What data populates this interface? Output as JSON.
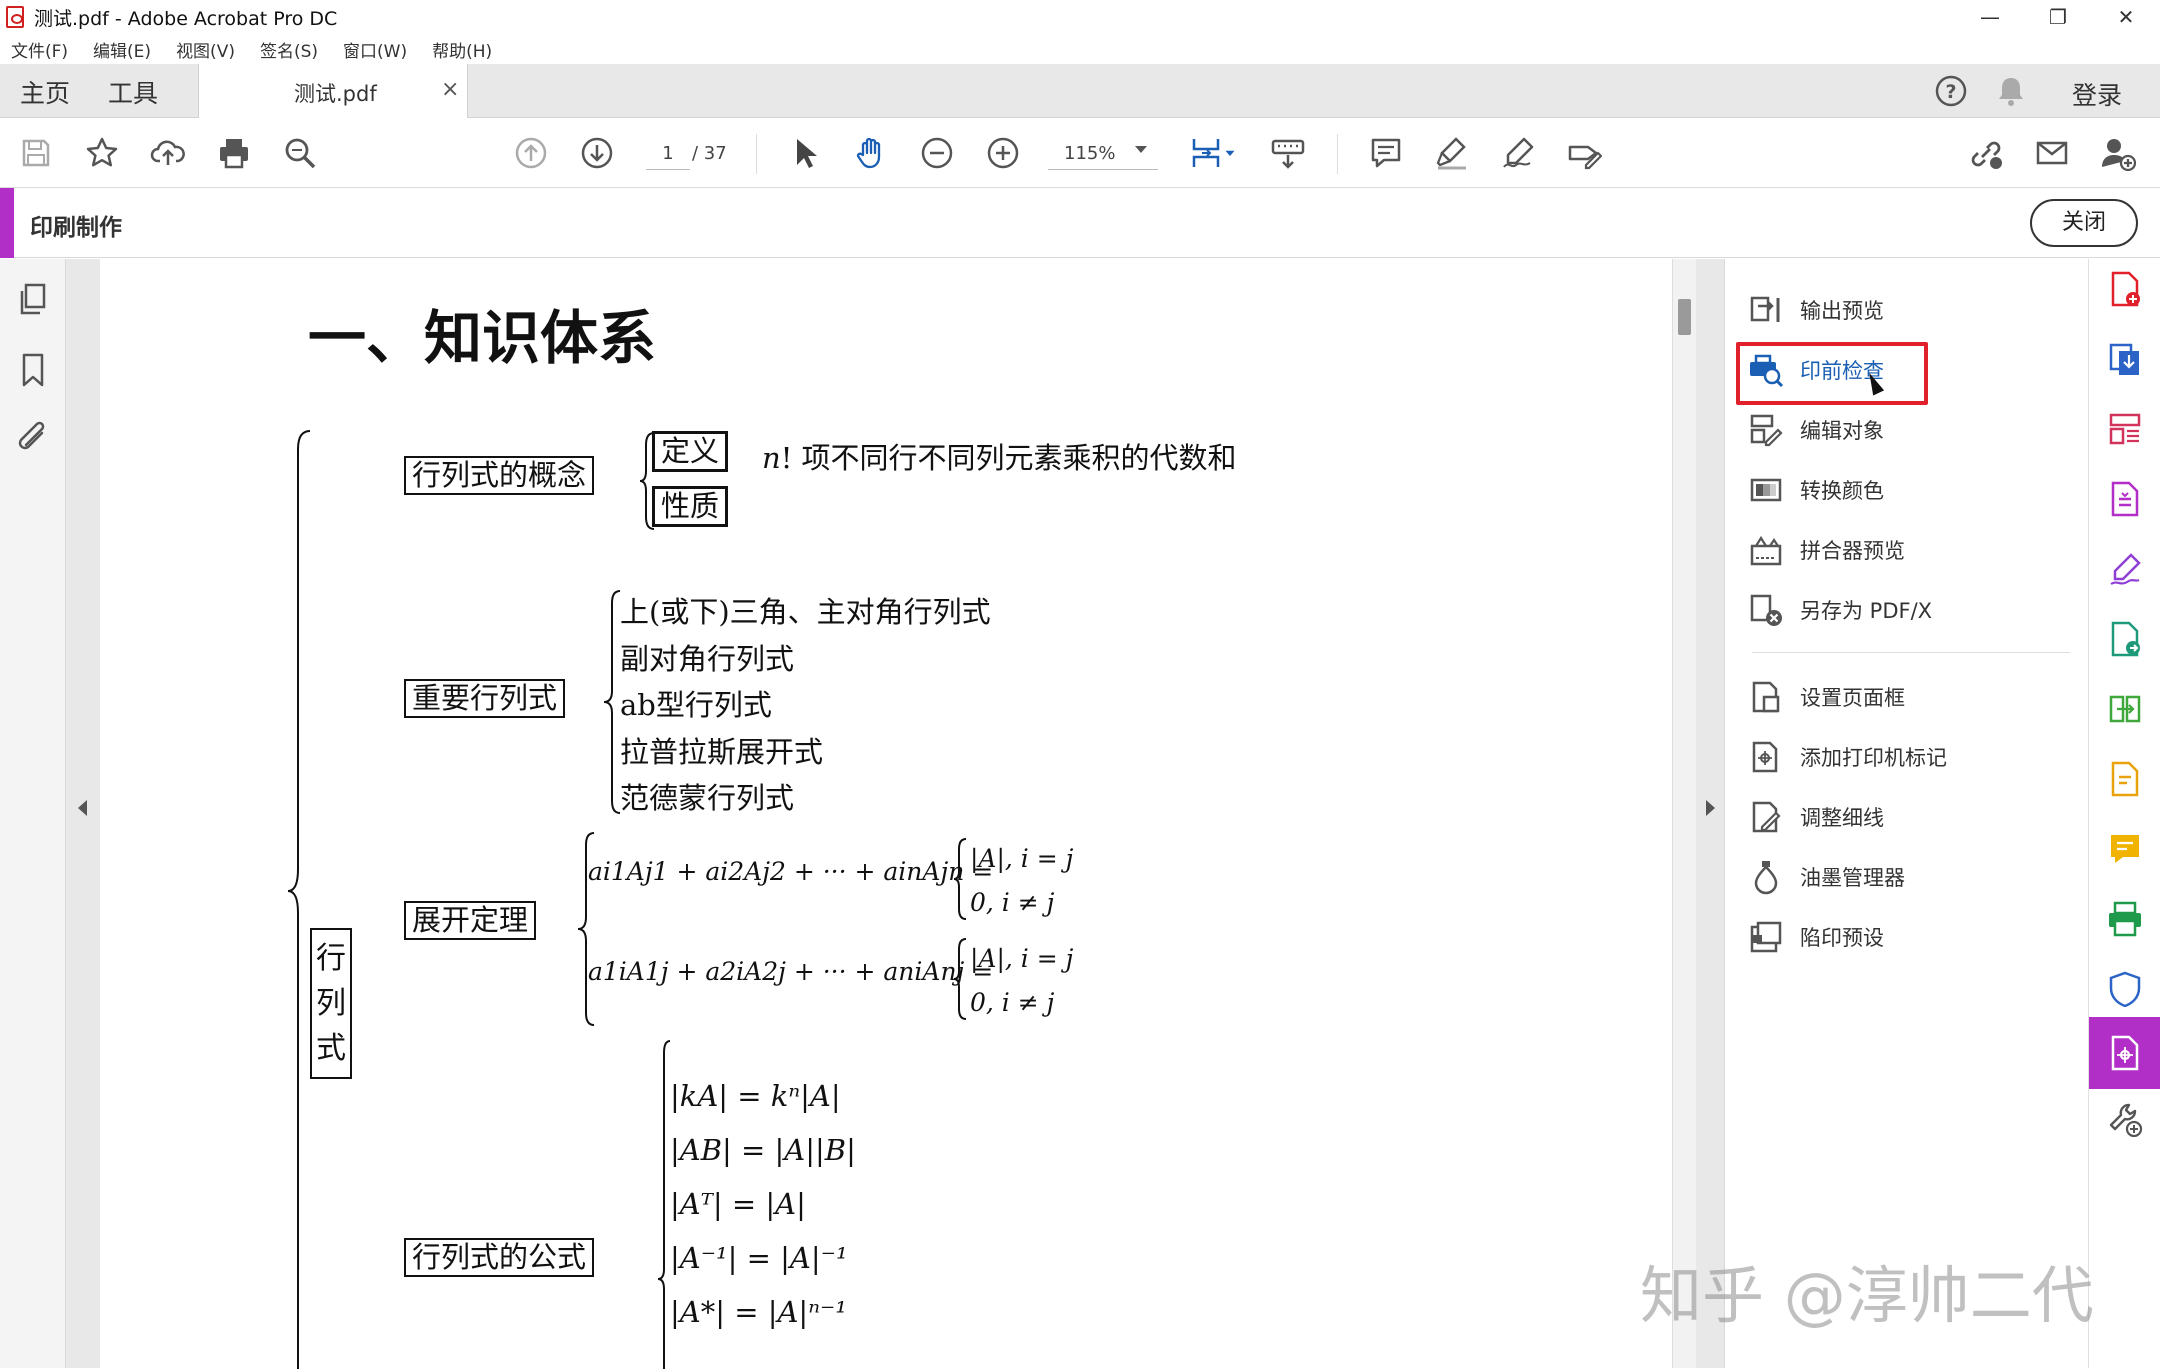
{
  "window": {
    "title": "测试.pdf - Adobe Acrobat Pro DC",
    "controls": [
      "—",
      "❐",
      "✕"
    ]
  },
  "menu": [
    "文件(F)",
    "编辑(E)",
    "视图(V)",
    "签名(S)",
    "窗口(W)",
    "帮助(H)"
  ],
  "tabs": {
    "home": "主页",
    "tools": "工具",
    "document": "测试.pdf",
    "close_glyph": "×",
    "login": "登录"
  },
  "toolbar": {
    "page_current": "1",
    "page_total": "/ 37",
    "zoom": "115%"
  },
  "tool_header": {
    "title": "印刷制作",
    "close_label": "关闭"
  },
  "right_panel": {
    "items": [
      {
        "label": "输出预览",
        "icon": "output-preview-icon"
      },
      {
        "label": "印前检查",
        "icon": "preflight-icon",
        "active": true
      },
      {
        "label": "编辑对象",
        "icon": "edit-object-icon"
      },
      {
        "label": "转换颜色",
        "icon": "convert-colors-icon"
      },
      {
        "label": "拼合器预览",
        "icon": "flattener-preview-icon"
      },
      {
        "label": "另存为 PDF/X",
        "icon": "save-pdfx-icon"
      },
      {
        "label": "设置页面框",
        "icon": "page-box-icon"
      },
      {
        "label": "添加打印机标记",
        "icon": "printer-marks-icon"
      },
      {
        "label": "调整细线",
        "icon": "fix-hairlines-icon"
      },
      {
        "label": "油墨管理器",
        "icon": "ink-manager-icon"
      },
      {
        "label": "陷印预设",
        "icon": "trap-presets-icon"
      }
    ],
    "highlight_color": "#e0202a"
  },
  "colors": {
    "accent": "#b12fc6",
    "active_blue": "#1a5fb4"
  },
  "document": {
    "heading": "一、知识体系",
    "root": "行列式",
    "concept": {
      "label": "行列式的概念",
      "definition": "定义",
      "property": "性质",
      "note_n": "n",
      "note": "! 项不同行不同列元素乘积的代数和"
    },
    "important": {
      "label": "重要行列式",
      "items": [
        "上(或下)三角、主对角行列式",
        "副对角行列式",
        "ab型行列式",
        "拉普拉斯展开式",
        "范德蒙行列式"
      ]
    },
    "expansion": {
      "label": "展开定理",
      "row_lhs": "ai1Aj1 + ai2Aj2 + ··· + ainAjn =",
      "col_lhs": "a1iA1j + a2iA2j + ··· + aniAnj =",
      "case1": "|A|, i = j",
      "case2": "0,  i ≠ j"
    },
    "formulas": {
      "label": "行列式的公式",
      "items": [
        "|kA| = kⁿ|A|",
        "|AB| = |A||B|",
        "|Aᵀ| = |A|",
        "|A⁻¹| = |A|⁻¹",
        "|A*| = |A|ⁿ⁻¹"
      ]
    }
  },
  "watermark": "知乎 @淳帅二代"
}
